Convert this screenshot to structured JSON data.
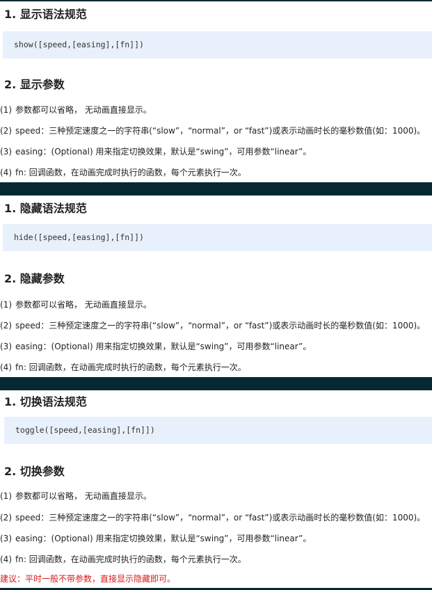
{
  "sections": [
    {
      "syntax_title": "1. 显示语法规范",
      "code": "show([speed,[easing],[fn]])",
      "params_title": "2. 显示参数",
      "params": [
        {
          "num": "(1)",
          "text": "参数都可以省略， 无动画直接显示。"
        },
        {
          "num": "(2)",
          "text": "speed：三种预定速度之一的字符串(“slow”，“normal”，or “fast”)或表示动画时长的毫秒数值(如：1000)。"
        },
        {
          "num": "(3)",
          "text": "easing：(Optional) 用来指定切换效果，默认是“swing”，可用参数“linear”。"
        },
        {
          "num": "(4)",
          "text": "fn: 回调函数，在动画完成时执行的函数，每个元素执行一次。"
        }
      ]
    },
    {
      "syntax_title": "1. 隐藏语法规范",
      "code": "hide([speed,[easing],[fn]])",
      "params_title": "2. 隐藏参数",
      "params": [
        {
          "num": "(1)",
          "text": "参数都可以省略， 无动画直接显示。"
        },
        {
          "num": "(2)",
          "text": "speed：三种预定速度之一的字符串(“slow”，“normal”，or “fast”)或表示动画时长的毫秒数值(如：1000)。"
        },
        {
          "num": "(3)",
          "text": "easing：(Optional) 用来指定切换效果，默认是“swing”，可用参数“linear”。"
        },
        {
          "num": "(4)",
          "text": "fn: 回调函数，在动画完成时执行的函数，每个元素执行一次。"
        }
      ]
    },
    {
      "syntax_title": "1. 切换语法规范",
      "code": "toggle([speed,[easing],[fn]])",
      "params_title": "2. 切换参数",
      "params": [
        {
          "num": "(1)",
          "text": "参数都可以省略， 无动画直接显示。"
        },
        {
          "num": "(2)",
          "text": "speed：三种预定速度之一的字符串(“slow”，“normal”，or “fast”)或表示动画时长的毫秒数值(如：1000)。"
        },
        {
          "num": "(3)",
          "text": "easing：(Optional) 用来指定切换效果，默认是“swing”，可用参数“linear”。"
        },
        {
          "num": "(4)",
          "text": "fn: 回调函数，在动画完成时执行的函数，每个元素执行一次。"
        }
      ],
      "note": "建议：平时一般不带参数，直接显示隐藏即可。"
    }
  ],
  "colors": {
    "divider": "#062833",
    "code_bg": "#e8f0fb",
    "note": "#d71a1a"
  }
}
